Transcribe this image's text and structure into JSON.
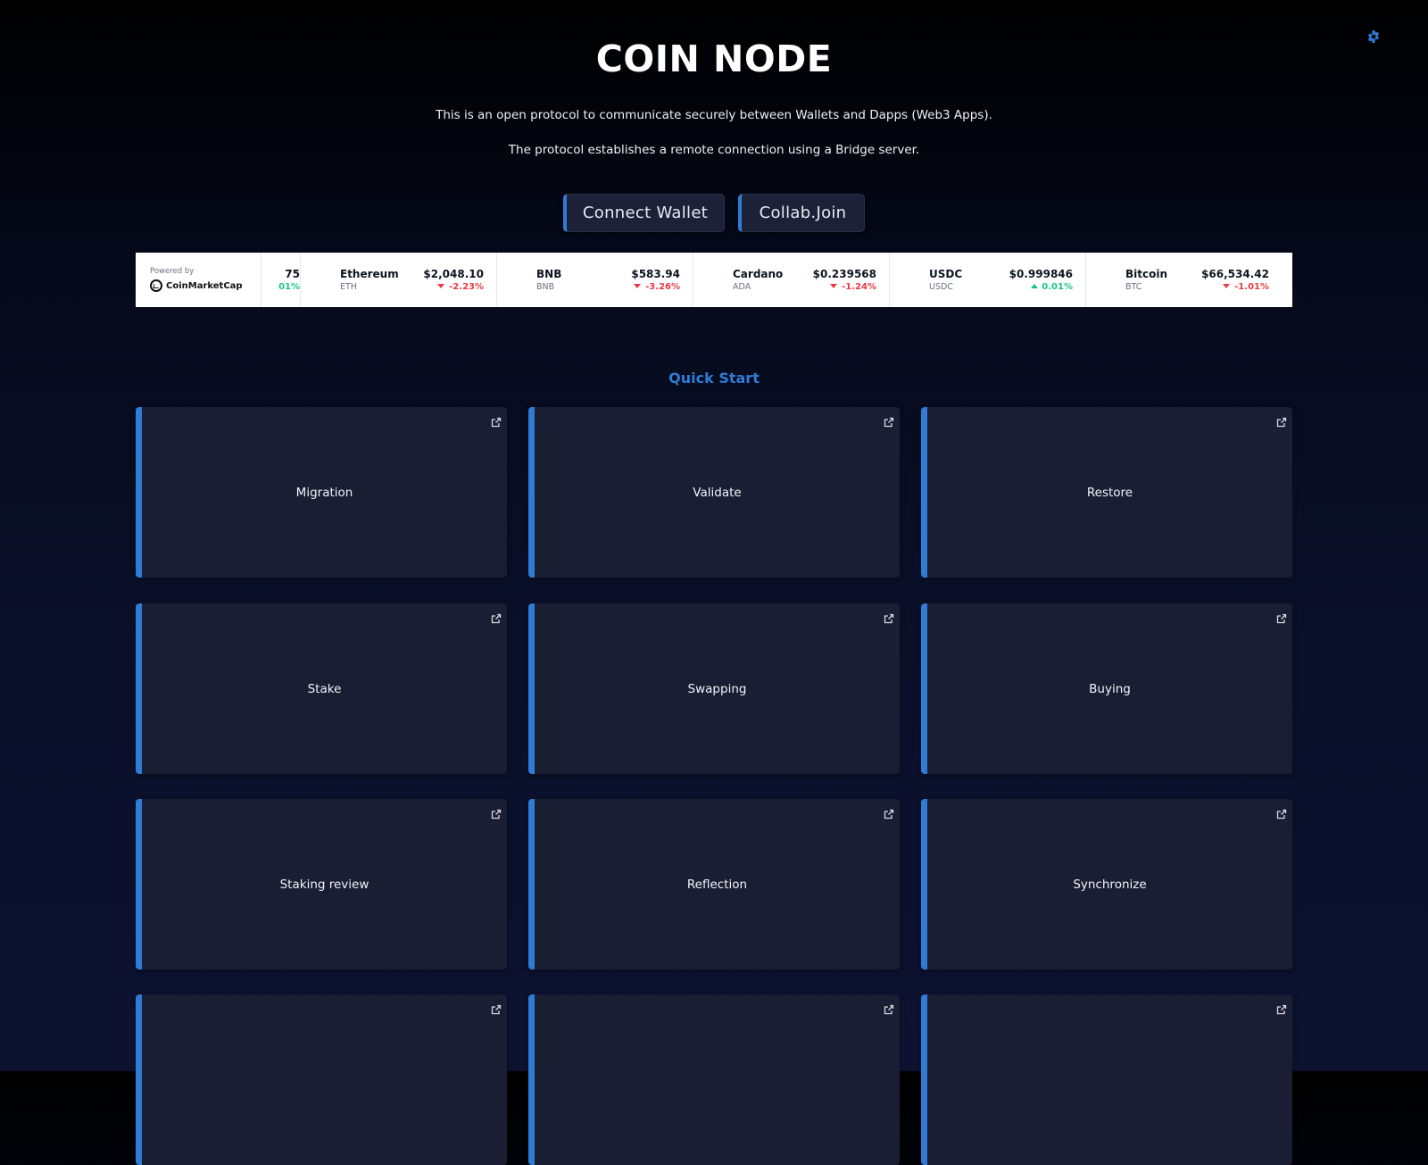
{
  "header": {
    "title": "COIN NODE",
    "description_1": "This is an open protocol to communicate securely between Wallets and Dapps (Web3 Apps).",
    "description_2": "The protocol establishes a remote connection using a Bridge server.",
    "settings_icon": "gear-icon",
    "accent_color": "#2f7bd6"
  },
  "actions": {
    "connect_wallet": "Connect Wallet",
    "collab_join": "Collab.Join"
  },
  "ticker": {
    "powered_by": "Powered by",
    "provider": "CoinMarketCap",
    "partial_price": "75",
    "partial_change": "01%",
    "coins": [
      {
        "name": "Ethereum",
        "symbol": "ETH",
        "price": "$2,048.10",
        "change": "-2.23%",
        "direction": "down"
      },
      {
        "name": "BNB",
        "symbol": "BNB",
        "price": "$583.94",
        "change": "-3.26%",
        "direction": "down"
      },
      {
        "name": "Cardano",
        "symbol": "ADA",
        "price": "$0.239568",
        "change": "-1.24%",
        "direction": "down"
      },
      {
        "name": "USDC",
        "symbol": "USDC",
        "price": "$0.999846",
        "change": "0.01%",
        "direction": "up"
      },
      {
        "name": "Bitcoin",
        "symbol": "BTC",
        "price": "$66,534.42",
        "change": "-1.01%",
        "direction": "down"
      }
    ],
    "colors": {
      "down": "#ea3943",
      "up": "#16c784"
    }
  },
  "quick_start": {
    "title": "Quick Start",
    "cards": [
      {
        "label": "Migration"
      },
      {
        "label": "Validate"
      },
      {
        "label": "Restore"
      },
      {
        "label": "Stake"
      },
      {
        "label": "Swapping"
      },
      {
        "label": "Buying"
      },
      {
        "label": "Staking review"
      },
      {
        "label": "Reflection"
      },
      {
        "label": "Synchronize"
      },
      {
        "label": ""
      },
      {
        "label": ""
      },
      {
        "label": ""
      }
    ],
    "card_icon": "external-link-icon"
  }
}
